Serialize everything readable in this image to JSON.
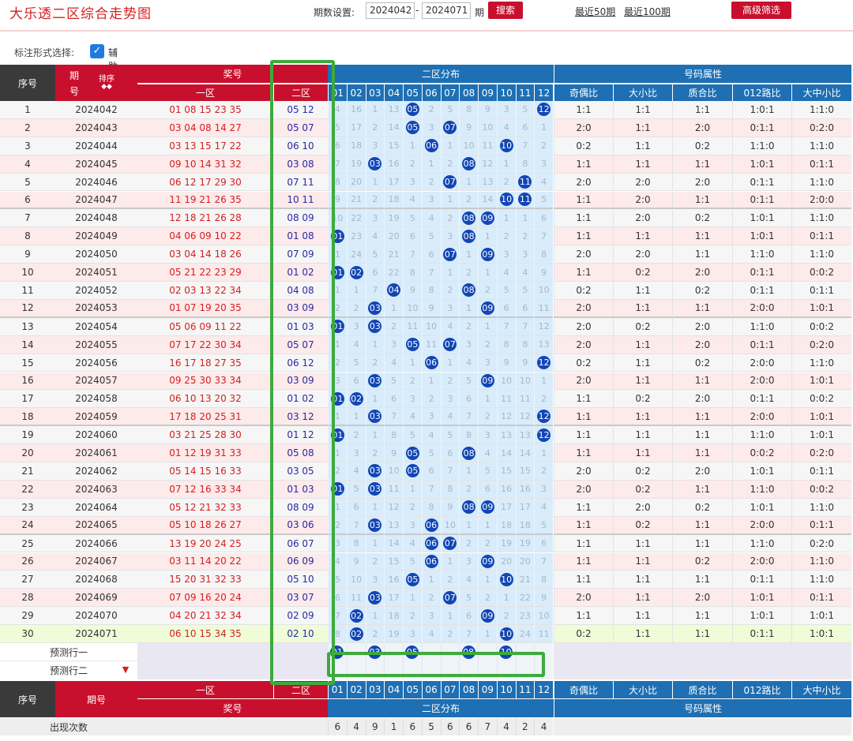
{
  "header": {
    "title": "大乐透二区综合走势图",
    "period_label": "期数设置:",
    "start": "2024042",
    "end": "2024071",
    "period_unit": "期",
    "search_btn": "搜索",
    "link50": "最近50期",
    "link100": "最近100期",
    "filter_btn": "高级筛选"
  },
  "options": {
    "label": "标注形式选择:",
    "aux_label": "辅助线",
    "aux_checked": true
  },
  "table_header": {
    "seq": "序号",
    "period_a": "期",
    "period_b": "号",
    "sort": "排序",
    "award": "奖号",
    "zone1": "一区",
    "zone2": "二区",
    "dist": "二区分布",
    "attr": "号码属性",
    "attrs": [
      "奇偶比",
      "大小比",
      "质合比",
      "012路比",
      "大中小比"
    ],
    "nums": [
      "01",
      "02",
      "03",
      "04",
      "05",
      "06",
      "07",
      "08",
      "09",
      "10",
      "11",
      "12"
    ]
  },
  "rows": [
    {
      "seq": "1",
      "period": "2024042",
      "z1": "01 08 15 23 35",
      "z2": "05 12",
      "d": [
        "4",
        "16",
        "1",
        "13",
        "B",
        "2",
        "5",
        "8",
        "9",
        "3",
        "5",
        "B"
      ],
      "a": [
        "1:1",
        "1:1",
        "1:1",
        "1:0:1",
        "1:1:0"
      ]
    },
    {
      "seq": "2",
      "period": "2024043",
      "z1": "03 04 08 14 27",
      "z2": "05 07",
      "d": [
        "5",
        "17",
        "2",
        "14",
        "B",
        "3",
        "B",
        "9",
        "10",
        "4",
        "6",
        "1"
      ],
      "a": [
        "2:0",
        "1:1",
        "2:0",
        "0:1:1",
        "0:2:0"
      ]
    },
    {
      "seq": "3",
      "period": "2024044",
      "z1": "03 13 15 17 22",
      "z2": "06 10",
      "d": [
        "6",
        "18",
        "3",
        "15",
        "1",
        "B",
        "1",
        "10",
        "11",
        "B",
        "7",
        "2"
      ],
      "a": [
        "0:2",
        "1:1",
        "0:2",
        "1:1:0",
        "1:1:0"
      ]
    },
    {
      "seq": "4",
      "period": "2024045",
      "z1": "09 10 14 31 32",
      "z2": "03 08",
      "d": [
        "7",
        "19",
        "B",
        "16",
        "2",
        "1",
        "2",
        "B",
        "12",
        "1",
        "8",
        "3"
      ],
      "a": [
        "1:1",
        "1:1",
        "1:1",
        "1:0:1",
        "0:1:1"
      ]
    },
    {
      "seq": "5",
      "period": "2024046",
      "z1": "06 12 17 29 30",
      "z2": "07 11",
      "d": [
        "8",
        "20",
        "1",
        "17",
        "3",
        "2",
        "B",
        "1",
        "13",
        "2",
        "B",
        "4"
      ],
      "a": [
        "2:0",
        "2:0",
        "2:0",
        "0:1:1",
        "1:1:0"
      ]
    },
    {
      "seq": "6",
      "period": "2024047",
      "z1": "11 19 21 26 35",
      "z2": "10 11",
      "d": [
        "9",
        "21",
        "2",
        "18",
        "4",
        "3",
        "1",
        "2",
        "14",
        "B",
        "B",
        "5"
      ],
      "a": [
        "1:1",
        "2:0",
        "1:1",
        "0:1:1",
        "2:0:0"
      ]
    },
    {
      "seq": "7",
      "period": "2024048",
      "z1": "12 18 21 26 28",
      "z2": "08 09",
      "d": [
        "10",
        "22",
        "3",
        "19",
        "5",
        "4",
        "2",
        "B",
        "B",
        "1",
        "1",
        "6"
      ],
      "a": [
        "1:1",
        "2:0",
        "0:2",
        "1:0:1",
        "1:1:0"
      ]
    },
    {
      "seq": "8",
      "period": "2024049",
      "z1": "04 06 09 10 22",
      "z2": "01 08",
      "d": [
        "B",
        "23",
        "4",
        "20",
        "6",
        "5",
        "3",
        "B",
        "1",
        "2",
        "2",
        "7"
      ],
      "a": [
        "1:1",
        "1:1",
        "1:1",
        "1:0:1",
        "0:1:1"
      ]
    },
    {
      "seq": "9",
      "period": "2024050",
      "z1": "03 04 14 18 26",
      "z2": "07 09",
      "d": [
        "1",
        "24",
        "5",
        "21",
        "7",
        "6",
        "B",
        "1",
        "B",
        "3",
        "3",
        "8"
      ],
      "a": [
        "2:0",
        "2:0",
        "1:1",
        "1:1:0",
        "1:1:0"
      ]
    },
    {
      "seq": "10",
      "period": "2024051",
      "z1": "05 21 22 23 29",
      "z2": "01 02",
      "d": [
        "B",
        "B",
        "6",
        "22",
        "8",
        "7",
        "1",
        "2",
        "1",
        "4",
        "4",
        "9"
      ],
      "a": [
        "1:1",
        "0:2",
        "2:0",
        "0:1:1",
        "0:0:2"
      ]
    },
    {
      "seq": "11",
      "period": "2024052",
      "z1": "02 03 13 22 34",
      "z2": "04 08",
      "d": [
        "1",
        "1",
        "7",
        "B",
        "9",
        "8",
        "2",
        "B",
        "2",
        "5",
        "5",
        "10"
      ],
      "a": [
        "0:2",
        "1:1",
        "0:2",
        "0:1:1",
        "0:1:1"
      ]
    },
    {
      "seq": "12",
      "period": "2024053",
      "z1": "01 07 19 20 35",
      "z2": "03 09",
      "d": [
        "2",
        "2",
        "B",
        "1",
        "10",
        "9",
        "3",
        "1",
        "B",
        "6",
        "6",
        "11"
      ],
      "a": [
        "2:0",
        "1:1",
        "1:1",
        "2:0:0",
        "1:0:1"
      ]
    },
    {
      "seq": "13",
      "period": "2024054",
      "z1": "05 06 09 11 22",
      "z2": "01 03",
      "d": [
        "B",
        "3",
        "B",
        "2",
        "11",
        "10",
        "4",
        "2",
        "1",
        "7",
        "7",
        "12"
      ],
      "a": [
        "2:0",
        "0:2",
        "2:0",
        "1:1:0",
        "0:0:2"
      ]
    },
    {
      "seq": "14",
      "period": "2024055",
      "z1": "07 17 22 30 34",
      "z2": "05 07",
      "d": [
        "1",
        "4",
        "1",
        "3",
        "B",
        "11",
        "B",
        "3",
        "2",
        "8",
        "8",
        "13"
      ],
      "a": [
        "2:0",
        "1:1",
        "2:0",
        "0:1:1",
        "0:2:0"
      ]
    },
    {
      "seq": "15",
      "period": "2024056",
      "z1": "16 17 18 27 35",
      "z2": "06 12",
      "d": [
        "2",
        "5",
        "2",
        "4",
        "1",
        "B",
        "1",
        "4",
        "3",
        "9",
        "9",
        "B"
      ],
      "a": [
        "0:2",
        "1:1",
        "0:2",
        "2:0:0",
        "1:1:0"
      ]
    },
    {
      "seq": "16",
      "period": "2024057",
      "z1": "09 25 30 33 34",
      "z2": "03 09",
      "d": [
        "3",
        "6",
        "B",
        "5",
        "2",
        "1",
        "2",
        "5",
        "B",
        "10",
        "10",
        "1"
      ],
      "a": [
        "2:0",
        "1:1",
        "1:1",
        "2:0:0",
        "1:0:1"
      ]
    },
    {
      "seq": "17",
      "period": "2024058",
      "z1": "06 10 13 20 32",
      "z2": "01 02",
      "d": [
        "B",
        "B",
        "1",
        "6",
        "3",
        "2",
        "3",
        "6",
        "1",
        "11",
        "11",
        "2"
      ],
      "a": [
        "1:1",
        "0:2",
        "2:0",
        "0:1:1",
        "0:0:2"
      ]
    },
    {
      "seq": "18",
      "period": "2024059",
      "z1": "17 18 20 25 31",
      "z2": "03 12",
      "d": [
        "1",
        "1",
        "B",
        "7",
        "4",
        "3",
        "4",
        "7",
        "2",
        "12",
        "12",
        "B"
      ],
      "a": [
        "1:1",
        "1:1",
        "1:1",
        "2:0:0",
        "1:0:1"
      ]
    },
    {
      "seq": "19",
      "period": "2024060",
      "z1": "03 21 25 28 30",
      "z2": "01 12",
      "d": [
        "B",
        "2",
        "1",
        "8",
        "5",
        "4",
        "5",
        "8",
        "3",
        "13",
        "13",
        "B"
      ],
      "a": [
        "1:1",
        "1:1",
        "1:1",
        "1:1:0",
        "1:0:1"
      ]
    },
    {
      "seq": "20",
      "period": "2024061",
      "z1": "01 12 19 31 33",
      "z2": "05 08",
      "d": [
        "1",
        "3",
        "2",
        "9",
        "B",
        "5",
        "6",
        "B",
        "4",
        "14",
        "14",
        "1"
      ],
      "a": [
        "1:1",
        "1:1",
        "1:1",
        "0:0:2",
        "0:2:0"
      ]
    },
    {
      "seq": "21",
      "period": "2024062",
      "z1": "05 14 15 16 33",
      "z2": "03 05",
      "d": [
        "2",
        "4",
        "B",
        "10",
        "B",
        "6",
        "7",
        "1",
        "5",
        "15",
        "15",
        "2"
      ],
      "a": [
        "2:0",
        "0:2",
        "2:0",
        "1:0:1",
        "0:1:1"
      ]
    },
    {
      "seq": "22",
      "period": "2024063",
      "z1": "07 12 16 33 34",
      "z2": "01 03",
      "d": [
        "B",
        "5",
        "B",
        "11",
        "1",
        "7",
        "8",
        "2",
        "6",
        "16",
        "16",
        "3"
      ],
      "a": [
        "2:0",
        "0:2",
        "1:1",
        "1:1:0",
        "0:0:2"
      ]
    },
    {
      "seq": "23",
      "period": "2024064",
      "z1": "05 12 21 32 33",
      "z2": "08 09",
      "d": [
        "1",
        "6",
        "1",
        "12",
        "2",
        "8",
        "9",
        "B",
        "B",
        "17",
        "17",
        "4"
      ],
      "a": [
        "1:1",
        "2:0",
        "0:2",
        "1:0:1",
        "1:1:0"
      ]
    },
    {
      "seq": "24",
      "period": "2024065",
      "z1": "05 10 18 26 27",
      "z2": "03 06",
      "d": [
        "2",
        "7",
        "B",
        "13",
        "3",
        "B",
        "10",
        "1",
        "1",
        "18",
        "18",
        "5"
      ],
      "a": [
        "1:1",
        "0:2",
        "1:1",
        "2:0:0",
        "0:1:1"
      ]
    },
    {
      "seq": "25",
      "period": "2024066",
      "z1": "13 19 20 24 25",
      "z2": "06 07",
      "d": [
        "3",
        "8",
        "1",
        "14",
        "4",
        "B",
        "B",
        "2",
        "2",
        "19",
        "19",
        "6"
      ],
      "a": [
        "1:1",
        "1:1",
        "1:1",
        "1:1:0",
        "0:2:0"
      ]
    },
    {
      "seq": "26",
      "period": "2024067",
      "z1": "03 11 14 20 22",
      "z2": "06 09",
      "d": [
        "4",
        "9",
        "2",
        "15",
        "5",
        "B",
        "1",
        "3",
        "B",
        "20",
        "20",
        "7"
      ],
      "a": [
        "1:1",
        "1:1",
        "0:2",
        "2:0:0",
        "1:1:0"
      ]
    },
    {
      "seq": "27",
      "period": "2024068",
      "z1": "15 20 31 32 33",
      "z2": "05 10",
      "d": [
        "5",
        "10",
        "3",
        "16",
        "B",
        "1",
        "2",
        "4",
        "1",
        "B",
        "21",
        "8"
      ],
      "a": [
        "1:1",
        "1:1",
        "1:1",
        "0:1:1",
        "1:1:0"
      ]
    },
    {
      "seq": "28",
      "period": "2024069",
      "z1": "07 09 16 20 24",
      "z2": "03 07",
      "d": [
        "6",
        "11",
        "B",
        "17",
        "1",
        "2",
        "B",
        "5",
        "2",
        "1",
        "22",
        "9"
      ],
      "a": [
        "2:0",
        "1:1",
        "2:0",
        "1:0:1",
        "0:1:1"
      ]
    },
    {
      "seq": "29",
      "period": "2024070",
      "z1": "04 20 21 32 34",
      "z2": "02 09",
      "d": [
        "7",
        "B",
        "1",
        "18",
        "2",
        "3",
        "1",
        "6",
        "B",
        "2",
        "23",
        "10"
      ],
      "a": [
        "1:1",
        "1:1",
        "1:1",
        "1:0:1",
        "1:0:1"
      ]
    },
    {
      "seq": "30",
      "period": "2024071",
      "z1": "06 10 15 34 35",
      "z2": "02 10",
      "d": [
        "8",
        "B",
        "2",
        "19",
        "3",
        "4",
        "2",
        "7",
        "1",
        "B",
        "24",
        "11"
      ],
      "a": [
        "0:2",
        "1:1",
        "1:1",
        "0:1:1",
        "1:0:1"
      ]
    }
  ],
  "forecast": {
    "row1_label": "预测行一",
    "row2_label": "预测行二",
    "balls": [
      "01",
      "03",
      "05",
      "08",
      "10"
    ],
    "ball_cols": [
      0,
      2,
      4,
      7,
      9
    ]
  },
  "footer": {
    "seq": "序号",
    "period": "期号",
    "zone1": "一区",
    "zone2": "二区",
    "award": "奖号",
    "dist": "二区分布",
    "attr": "号码属性",
    "counts_label": "出现次数",
    "counts": [
      "6",
      "4",
      "9",
      "1",
      "6",
      "5",
      "6",
      "6",
      "7",
      "4",
      "2",
      "4"
    ]
  },
  "colors": {
    "red": "#c8102e",
    "blue": "#1e6fb3",
    "ball": "#1246b5",
    "green": "#3daa3d"
  }
}
